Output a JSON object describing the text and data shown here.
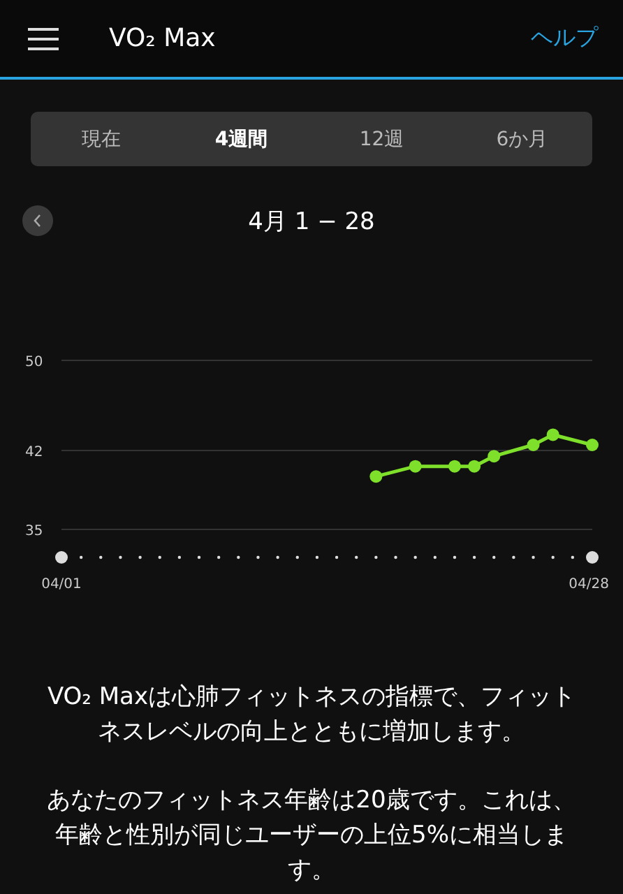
{
  "header": {
    "title": "VO₂ Max",
    "help_link": "ヘルプ"
  },
  "tabs": [
    {
      "label": "現在",
      "selected": false
    },
    {
      "label": "4週間",
      "selected": true
    },
    {
      "label": "12週",
      "selected": false
    },
    {
      "label": "6か月",
      "selected": false
    }
  ],
  "date_range": "4月 1 − 28",
  "chart_data": {
    "type": "line",
    "categories": [
      "04/01",
      null,
      null,
      null,
      null,
      null,
      null,
      null,
      null,
      null,
      null,
      null,
      null,
      null,
      null,
      null,
      null,
      null,
      null,
      null,
      null,
      null,
      null,
      null,
      null,
      null,
      null,
      "04/28"
    ],
    "series": [
      {
        "color": "#7ee02a",
        "marker": "circle",
        "values": [
          null,
          null,
          null,
          null,
          null,
          null,
          null,
          null,
          null,
          null,
          null,
          null,
          null,
          null,
          null,
          null,
          39.7,
          null,
          40.6,
          null,
          40.6,
          40.6,
          41.5,
          null,
          42.5,
          43.4,
          null,
          42.5
        ]
      }
    ],
    "ylim": [
      35,
      50
    ],
    "yticks": [
      35,
      42,
      50
    ],
    "grid": true
  },
  "paragraphs": [
    "VO₂ Maxは心肺フィットネスの指標で、フィットネスレベルの向上とともに増加します。",
    "あなたのフィットネス年齢は20歳です。これは、年齢と性別が同じユーザーの上位5%に相当します。"
  ]
}
